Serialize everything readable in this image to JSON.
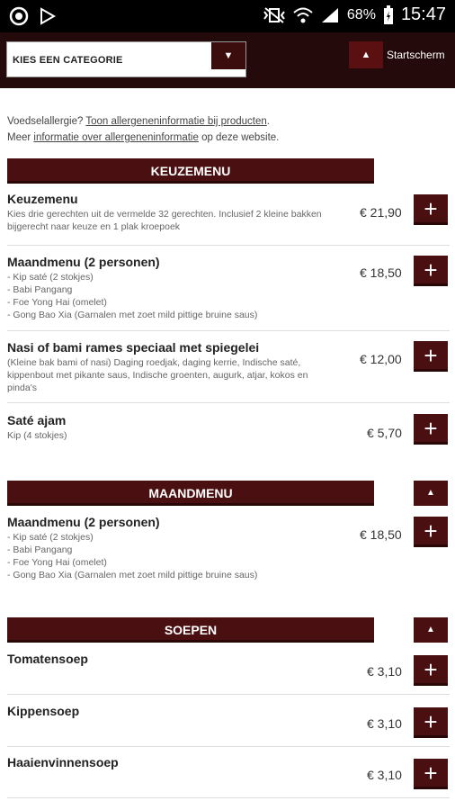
{
  "status": {
    "battery": "68%",
    "time": "15:47"
  },
  "topbar": {
    "category_placeholder": "KIES EEN CATEGORIE",
    "select_arrow": "▼",
    "home_arrow": "▲",
    "home_label": "Startscherm"
  },
  "allergen": {
    "line1_prefix": "Voedselallergie? ",
    "line1_link": "Toon allergeneninformatie bij producten",
    "line1_suffix": ".",
    "line2_prefix": "Meer ",
    "line2_link": "informatie over allergeneninformatie",
    "line2_suffix": " op deze website."
  },
  "sections": [
    {
      "title": "KEUZEMENU",
      "items": [
        {
          "title": "Keuzemenu",
          "desc": "Kies drie gerechten uit de vermelde 32 gerechten. Inclusief 2 kleine bakken bijgerecht naar keuze en 1 plak kroepoek",
          "price": "€ 21,90"
        },
        {
          "title": "Maandmenu (2 personen)",
          "desc": "- Kip saté (2 stokjes)\n- Babi Pangang\n- Foe Yong Hai (omelet)\n- Gong Bao Xia (Garnalen met zoet mild pittige bruine saus)",
          "price": "€ 18,50"
        },
        {
          "title": "Nasi of bami rames speciaal met spiegelei",
          "desc": "(Kleine bak bami of nasi) Daging roedjak, daging kerrie, Indische saté, kippenbout met pikante saus, Indische groenten, augurk, atjar, kokos en pinda's",
          "price": "€ 12,00"
        },
        {
          "title": "Saté ajam",
          "desc": "Kip (4 stokjes)",
          "price": "€ 5,70"
        }
      ]
    },
    {
      "title": "MAANDMENU",
      "items": [
        {
          "title": "Maandmenu (2 personen)",
          "desc": "- Kip saté (2 stokjes)\n- Babi Pangang\n- Foe Yong Hai (omelet)\n- Gong Bao Xia (Garnalen met zoet mild pittige bruine saus)",
          "price": "€ 18,50"
        }
      ]
    },
    {
      "title": "SOEPEN",
      "items": [
        {
          "title": "Tomatensoep",
          "desc": "",
          "price": "€ 3,10"
        },
        {
          "title": "Kippensoep",
          "desc": "",
          "price": "€ 3,10"
        },
        {
          "title": "Haaienvinnensoep",
          "desc": "",
          "price": "€ 3,10"
        }
      ]
    }
  ],
  "buttons": {
    "add": "+",
    "collapse": "▲"
  },
  "colors": {
    "brand": "#4a0f10",
    "header_bg": "#240a0a"
  }
}
